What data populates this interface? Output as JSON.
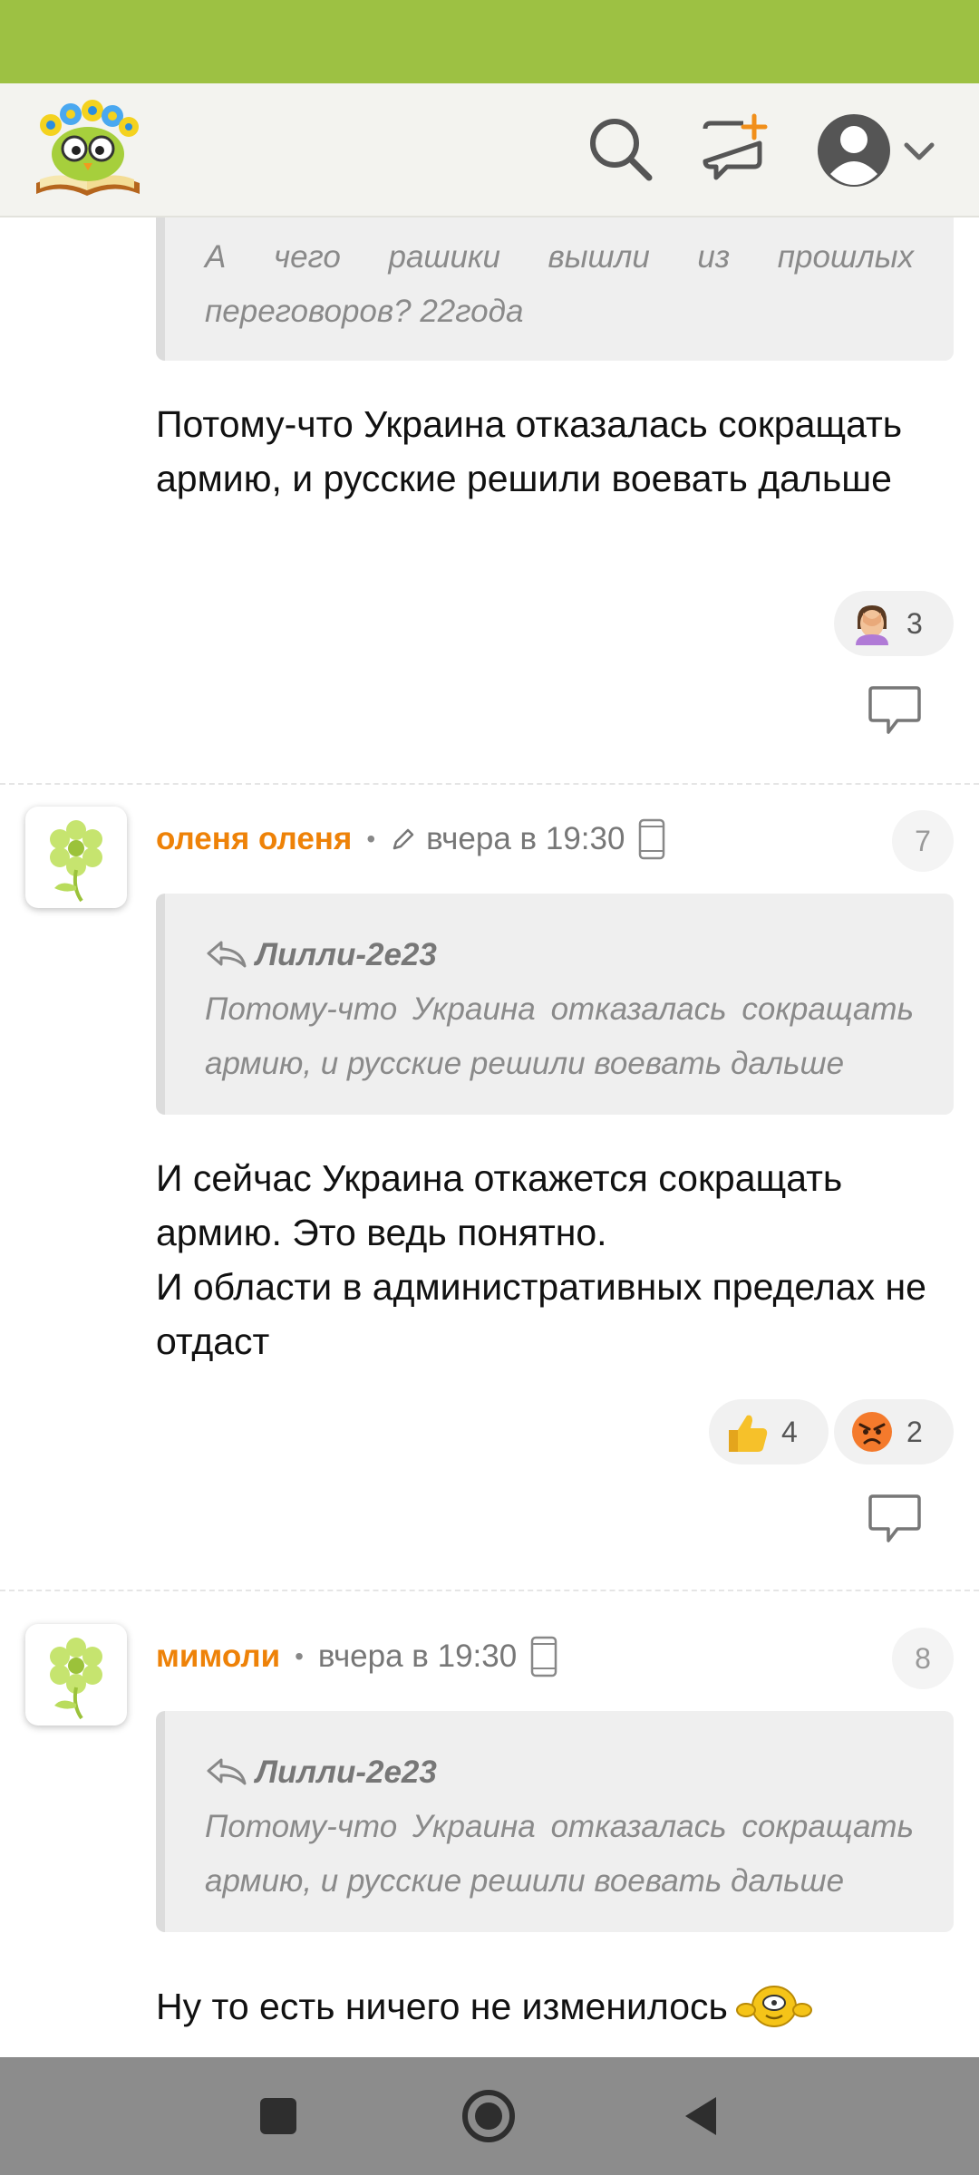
{
  "header": {
    "logo": "owl-flower-logo",
    "icons": [
      "search-icon",
      "new-post-icon",
      "user-avatar-icon",
      "chevron-down-icon"
    ]
  },
  "posts": [
    {
      "quote_text": "А чего рашики вышли из прошлых переговоров? 22года",
      "text": "Потому-что Украина отказалась сокращать армию, и русские решили воевать дальше",
      "reactions": [
        {
          "emoji": "facepalm-emoji",
          "count": "3"
        }
      ]
    },
    {
      "author": "оленя оленя",
      "edited_icon": "pencil-icon",
      "time": "вчера в 19:30",
      "device_icon": "phone-icon",
      "number": "7",
      "quote_author": "Лилли-2е23",
      "quote_text": "Потому-что Украина отказалась сокращать армию, и русские решили воевать дальше",
      "text": "И сейчас Украина откажется сокращать армию. Это ведь понятно.\nИ области в административных пределах не отдаст",
      "reactions": [
        {
          "emoji": "thumbs-up-emoji",
          "count": "4"
        },
        {
          "emoji": "angry-face-emoji",
          "count": "2"
        }
      ]
    },
    {
      "author": "мимоли",
      "time": "вчера в 19:30",
      "device_icon": "phone-icon",
      "number": "8",
      "quote_author": "Лилли-2е23",
      "quote_text": "Потому-что Украина отказалась сокращать армию, и русские решили воевать дальше",
      "text": "Ну то есть ничего не изменилось",
      "smiley": "smiley-emoticon"
    }
  ],
  "nav": [
    "recent-apps-button",
    "home-button",
    "back-button"
  ],
  "colors": {
    "status_bar": "#9dc143",
    "header_bg": "#f3f3ef",
    "author": "#ee8208",
    "nav_bar": "#8c8c8c"
  }
}
